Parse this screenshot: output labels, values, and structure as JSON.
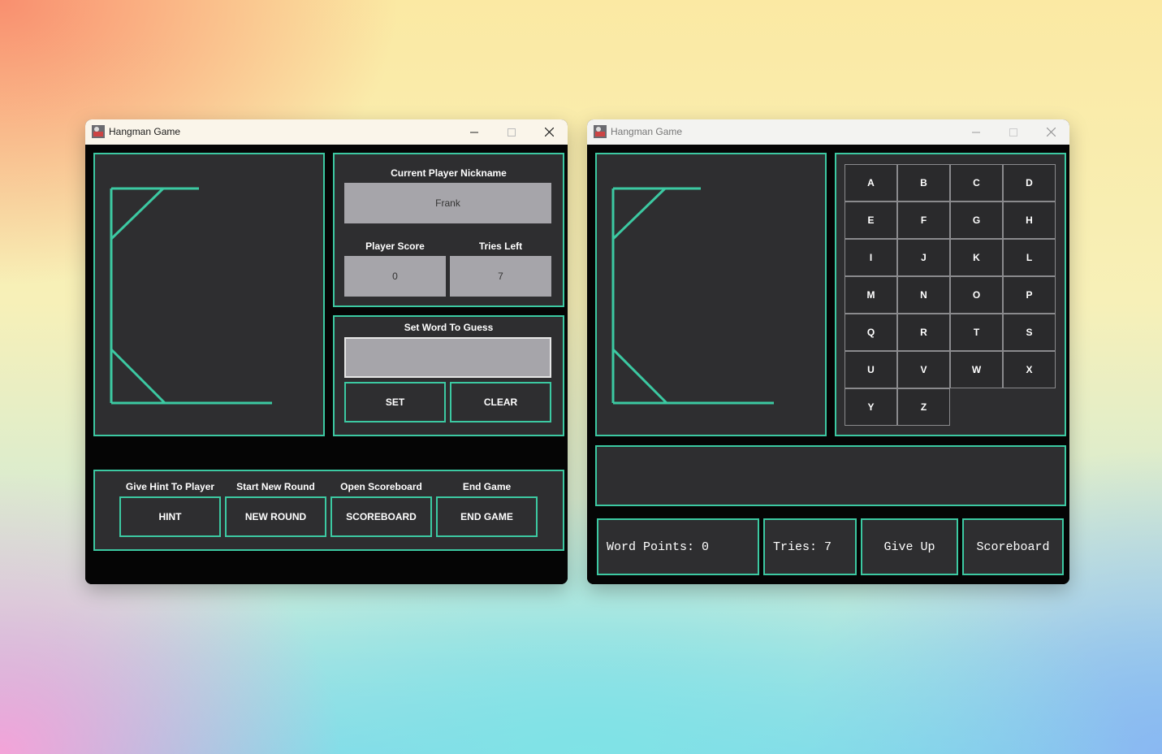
{
  "colors": {
    "accent": "#3cc9a2",
    "panel": "#2e2e30",
    "window_bg": "#050505",
    "field": "#a6a5aa"
  },
  "window_left": {
    "title": "Hangman Game",
    "controls": {
      "minimize": "minimize-icon",
      "maximize": "maximize-icon",
      "close": "close-icon"
    },
    "player": {
      "nickname_label": "Current Player Nickname",
      "nickname_value": "Frank",
      "score_label": "Player Score",
      "score_value": "0",
      "tries_label": "Tries Left",
      "tries_value": "7"
    },
    "word_setter": {
      "label": "Set Word To Guess",
      "input_value": "",
      "set_label": "SET",
      "clear_label": "CLEAR"
    },
    "actions": [
      {
        "caption": "Give Hint To Player",
        "button": "HINT"
      },
      {
        "caption": "Start New Round",
        "button": "NEW ROUND"
      },
      {
        "caption": "Open Scoreboard",
        "button": "SCOREBOARD"
      },
      {
        "caption": "End Game",
        "button": "END GAME"
      }
    ]
  },
  "window_right": {
    "title": "Hangman Game",
    "controls": {
      "minimize": "minimize-icon",
      "maximize": "maximize-icon",
      "close": "close-icon"
    },
    "letters": [
      "A",
      "B",
      "C",
      "D",
      "E",
      "F",
      "G",
      "H",
      "I",
      "J",
      "K",
      "L",
      "M",
      "N",
      "O",
      "P",
      "Q",
      "R",
      "T",
      "S",
      "U",
      "V",
      "W",
      "X",
      "Y",
      "Z"
    ],
    "word_display": "",
    "word_points_label": "Word Points:  0",
    "tries_label": "Tries:  7",
    "give_up_label": "Give Up",
    "scoreboard_label": "Scoreboard"
  }
}
